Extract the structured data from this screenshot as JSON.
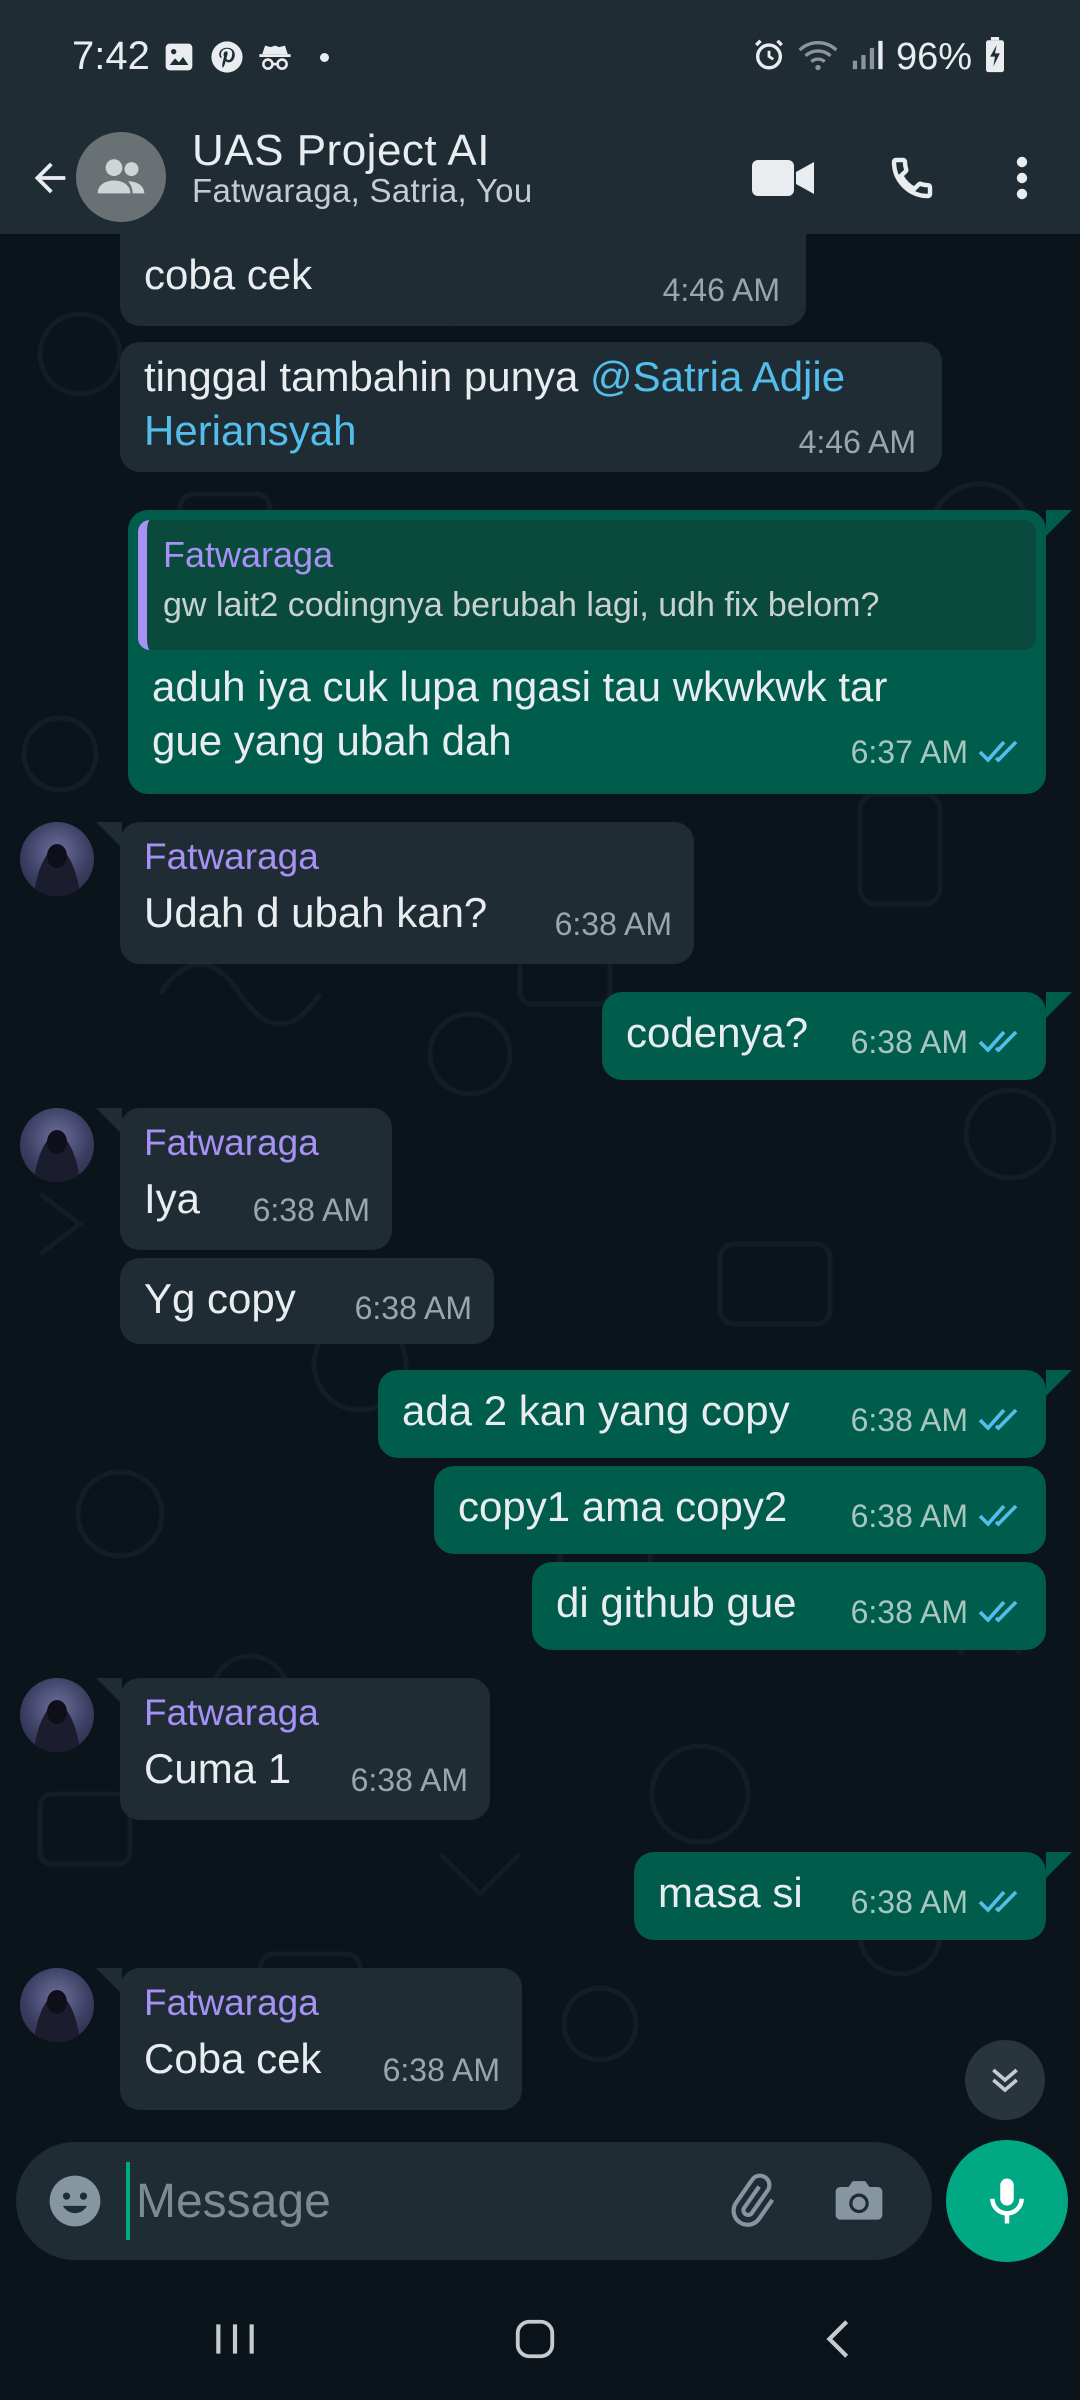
{
  "status_bar": {
    "time": "7:42",
    "battery": "96%",
    "left_icons": [
      "gallery-icon",
      "pinterest-icon",
      "incognito-icon",
      "dot"
    ],
    "right_icons": [
      "alarm-icon",
      "wifi-icon",
      "signal-icon",
      "battery-icon"
    ]
  },
  "header": {
    "title": "UAS Project AI",
    "subtitle": "Fatwaraga, Satria, You"
  },
  "messages": [
    {
      "dir": "in",
      "text": "coba cek",
      "time": "4:46 AM"
    },
    {
      "dir": "in",
      "text_before": "tinggal tambahin punya ",
      "mention": "@Satria Adjie",
      "mention2": "Heriansyah",
      "time": "4:46 AM"
    },
    {
      "dir": "out",
      "quote_name": "Fatwaraga",
      "quote_text": "gw lait2 codingnya berubah lagi, udh fix belom?",
      "line1": "aduh iya cuk lupa ngasi tau wkwkwk tar",
      "line2": "gue yang ubah dah",
      "time": "6:37 AM"
    },
    {
      "dir": "in",
      "sender": "Fatwaraga",
      "text": "Udah d ubah kan?",
      "time": "6:38 AM"
    },
    {
      "dir": "out",
      "text": "codenya?",
      "time": "6:38 AM"
    },
    {
      "dir": "in",
      "sender": "Fatwaraga",
      "text": "Iya",
      "time": "6:38 AM"
    },
    {
      "dir": "in",
      "text": "Yg copy",
      "time": "6:38 AM"
    },
    {
      "dir": "out",
      "text": "ada 2 kan yang copy",
      "time": "6:38 AM"
    },
    {
      "dir": "out",
      "text": "copy1 ama copy2",
      "time": "6:38 AM"
    },
    {
      "dir": "out",
      "text": "di github gue",
      "time": "6:38 AM"
    },
    {
      "dir": "in",
      "sender": "Fatwaraga",
      "text": "Cuma 1",
      "time": "6:38 AM"
    },
    {
      "dir": "out",
      "text": "masa si",
      "time": "6:38 AM"
    },
    {
      "dir": "in",
      "sender": "Fatwaraga",
      "text": "Coba cek",
      "time": "6:38 AM"
    }
  ],
  "input": {
    "placeholder": "Message"
  },
  "colors": {
    "incoming_bubble": "#202c33",
    "outgoing_bubble": "#005c4b",
    "accent": "#00a884",
    "sender_name": "#a791f6",
    "mention": "#53bdeb",
    "read_ticks": "#53bdeb"
  }
}
